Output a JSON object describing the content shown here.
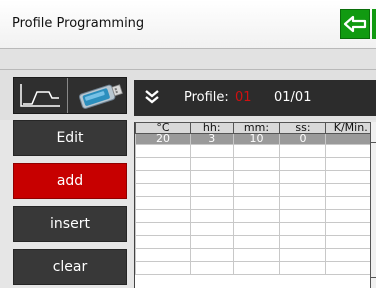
{
  "window": {
    "title": "Profile Programming"
  },
  "header_buttons": {
    "back_icon": "back-arrow-icon",
    "help_label": "?"
  },
  "toolbar": {
    "chart_icon": "profile-curve-icon",
    "usb_icon": "usb-stick-icon",
    "expand_icon": "double-chevron-down-icon",
    "profile_label": "Profile:",
    "profile_number": "01",
    "profile_position": "01/01"
  },
  "sidebar": {
    "buttons": [
      {
        "label": "Edit",
        "active": false
      },
      {
        "label": "add",
        "active": true
      },
      {
        "label": "insert",
        "active": false
      },
      {
        "label": "clear",
        "active": false
      }
    ]
  },
  "table": {
    "headers": [
      "°C",
      "hh:",
      "mm:",
      "ss:",
      "K/Min."
    ],
    "rows": [
      [
        "20",
        "3",
        "10",
        "0",
        ""
      ]
    ]
  },
  "colors": {
    "accent_red": "#c70000",
    "back_green": "#119a11",
    "panel_dark": "#2c2c2c"
  }
}
